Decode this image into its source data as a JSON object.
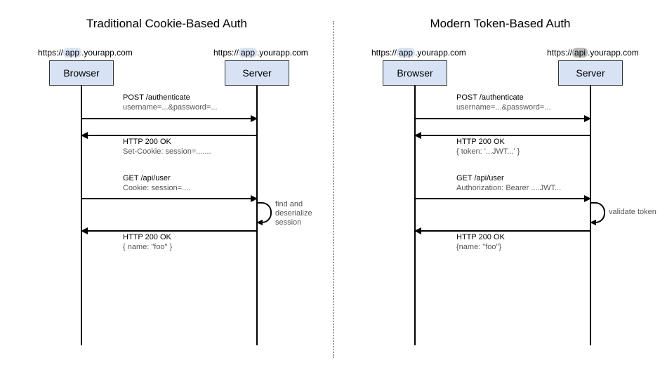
{
  "left": {
    "title": "Traditional Cookie-Based Auth",
    "browser_url_pre": "https://",
    "browser_url_hl": "app",
    "browser_url_post": ".yourapp.com",
    "server_url_pre": "https://",
    "server_url_hl": "app",
    "server_url_post": ".yourapp.com",
    "browser_box": "Browser",
    "server_box": "Server",
    "m1a": "POST /authenticate",
    "m1b": "username=...&password=...",
    "m2a": "HTTP 200 OK",
    "m2b": "Set-Cookie: session=.......",
    "m3a": "GET /api/user",
    "m3b": "Cookie: session=....",
    "loop": "find and\ndeserialize\nsession",
    "m4a": "HTTP 200 OK",
    "m4b": "{  name: \"foo\" }"
  },
  "right": {
    "title": "Modern Token-Based Auth",
    "browser_url_pre": "https://",
    "browser_url_hl": "app",
    "browser_url_post": ".yourapp.com",
    "server_url_pre": "https://",
    "server_url_hl": "api",
    "server_url_post": ".yourapp.com",
    "browser_box": "Browser",
    "server_box": "Server",
    "m1a": "POST /authenticate",
    "m1b": "username=...&password=...",
    "m2a": "HTTP 200 OK",
    "m2b": "{ token: '...JWT...' }",
    "m3a": "GET /api/user",
    "m3b": "Authorization: Bearer ....JWT...",
    "loop": "validate token",
    "m4a": "HTTP 200 OK",
    "m4b": "{name: \"foo\"}"
  }
}
